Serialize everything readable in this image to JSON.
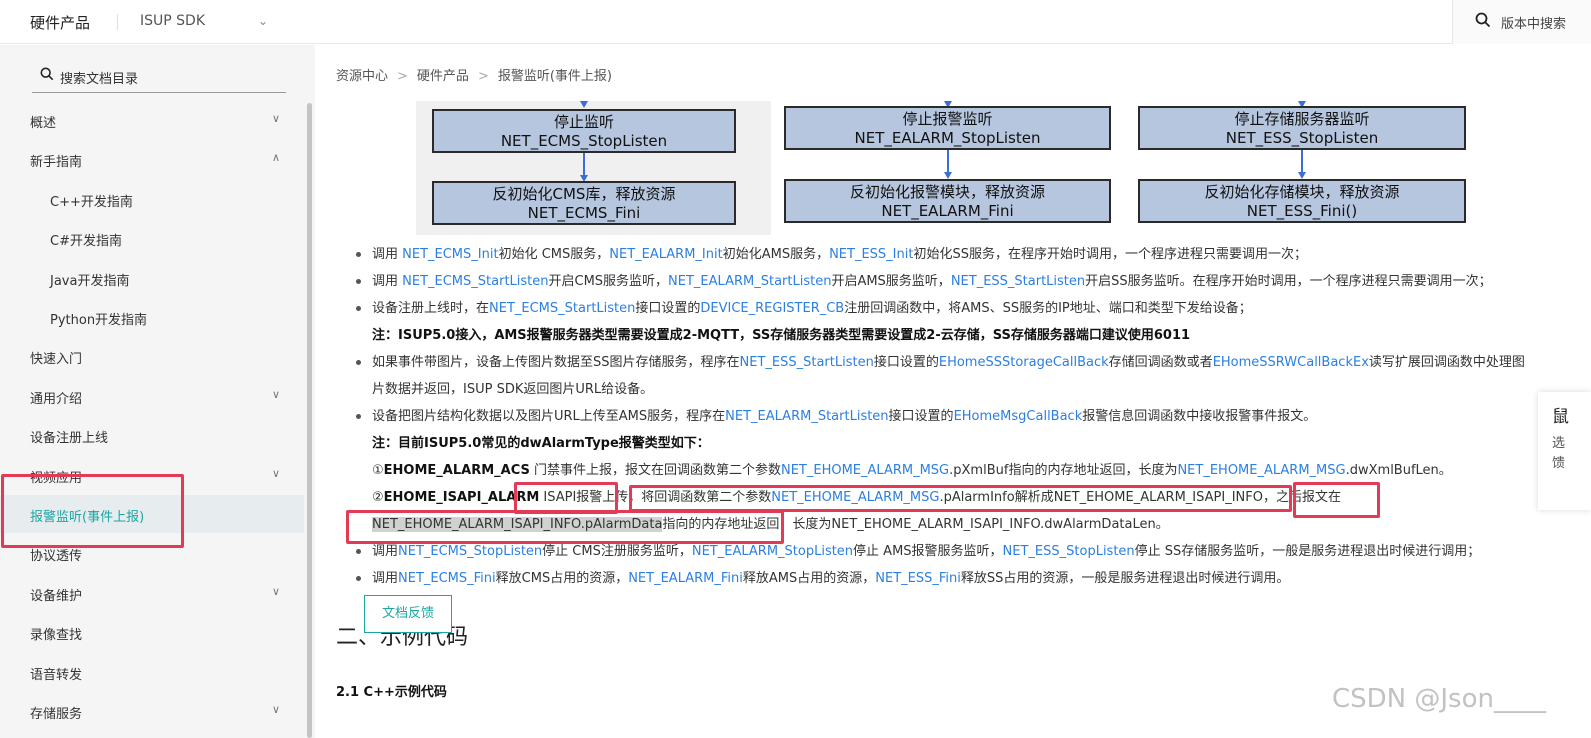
{
  "header": {
    "brand": "硬件产品",
    "product": "ISUP SDK",
    "search_placeholder": "版本中搜索"
  },
  "sidebar": {
    "search_placeholder": "搜索文档目录",
    "items": [
      {
        "label": "概述",
        "chevron": "∨"
      },
      {
        "label": "新手指南",
        "chevron": "∧"
      },
      {
        "label": "C++开发指南",
        "chevron": ""
      },
      {
        "label": "C#开发指南",
        "chevron": ""
      },
      {
        "label": "Java开发指南",
        "chevron": ""
      },
      {
        "label": "Python开发指南",
        "chevron": ""
      },
      {
        "label": "快速入门",
        "chevron": ""
      },
      {
        "label": "通用介绍",
        "chevron": "∨"
      },
      {
        "label": "设备注册上线",
        "chevron": ""
      },
      {
        "label": "视频应用",
        "chevron": "∨"
      },
      {
        "label": "报警监听(事件上报)",
        "chevron": ""
      },
      {
        "label": "协议透传",
        "chevron": ""
      },
      {
        "label": "设备维护",
        "chevron": "∨"
      },
      {
        "label": "录像查找",
        "chevron": ""
      },
      {
        "label": "语音转发",
        "chevron": ""
      },
      {
        "label": "存储服务",
        "chevron": "∨"
      }
    ]
  },
  "breadcrumb": [
    "资源中心",
    "硬件产品",
    "报警监听(事件上报)"
  ],
  "flowchart": {
    "stop_cms": [
      "停止监听",
      "NET_ECMS_StopListen"
    ],
    "fini_cms": [
      "反初始化CMS库，释放资源",
      "NET_ECMS_Fini"
    ],
    "stop_alarm": [
      "停止报警监听",
      "NET_EALARM_StopListen"
    ],
    "fini_alarm": [
      "反初始化报警模块，释放资源",
      "NET_EALARM_Fini"
    ],
    "stop_ess": [
      "停止存储服务器监听",
      "NET_ESS_StopListen"
    ],
    "fini_ess": [
      "反初始化存储模块，释放资源",
      "NET_ESS_Fini()"
    ]
  },
  "content": {
    "b1": [
      "调用 ",
      "NET_ECMS_Init",
      "初始化 CMS服务，",
      "NET_EALARM_Init",
      "初始化AMS服务，",
      "NET_ESS_Init",
      "初始化SS服务，在程序开始时调用，一个程序进程只需要调用一次；"
    ],
    "b2": [
      "调用 ",
      "NET_ECMS_StartListen",
      "开启CMS服务监听，",
      "NET_EALARM_StartListen",
      "开启AMS服务监听，",
      "NET_ESS_StartListen",
      "开启SS服务监听。在程序开始时调用，一个程序进程只需要调用一次；"
    ],
    "b3": [
      "设备注册上线时，在",
      "NET_ECMS_StartListen",
      "接口设置的",
      "DEVICE_REGISTER_CB",
      "注册回调函数中，将AMS、SS服务的IP地址、端口和类型下发给设备；"
    ],
    "note1": "注：ISUP5.0接入，AMS报警服务器类型需要设置成2-MQTT，SS存储服务器类型需要设置成2-云存储，SS存储服务器端口建议使用6011",
    "b4": [
      "如果事件带图片，设备上传图片数据至SS图片存储服务，程序在",
      "NET_ESS_StartListen",
      "接口设置的",
      "EHomeSSStorageCallBack",
      "存储回调函数或者",
      "EHomeSSRWCallBackEx",
      "读写扩展回调函数中处理图"
    ],
    "b4_cont": "片数据并返回，ISUP SDK返回图片URL给设备。",
    "b5": [
      "设备把图片结构化数据以及图片URL上传至AMS服务，程序在",
      "NET_EALARM_StartListen",
      "接口设置的",
      "EHomeMsgCallBack",
      "报警信息回调函数中接收报警事件报文。"
    ],
    "note2": "注：目前ISUP5.0常见的dwAlarmType报警类型如下：",
    "acs": [
      "①",
      "EHOME_ALARM_ACS",
      " 门禁事件上报，报文在回调函数第二个参数",
      "NET_EHOME_ALARM_MSG",
      ".pXmlBuf指向的内存地址返回，长度为",
      "NET_EHOME_ALARM_MSG",
      ".dwXmlBufLen。"
    ],
    "isapi": [
      "②",
      "EHOME_ISAPI_ALARM",
      " ISAPI报警上传，将回调函数第二个参数",
      "NET_EHOME_ALARM_MSG",
      ".pAlarmInfo解析成NET_EHOME_ALARM_ISAPI_INFO，之后报文在"
    ],
    "isapi_cont": [
      "NET_EHOME_ALARM_ISAPI_INFO.pAlarmData",
      "指向的内存地址返回，长度为NET_EHOME_ALARM_ISAPI_INFO.dwAlarmDataLen。"
    ],
    "b6": [
      "调用",
      "NET_ECMS_StopListen",
      "停止 CMS注册服务监听，",
      "NET_EALARM_StopListen",
      "停止 AMS报警服务监听，",
      "NET_ESS_StopListen",
      "停止 SS存储服务监听，一般是服务进程退出时候进行调用；"
    ],
    "b7": [
      "调用",
      "NET_ECMS_Fini",
      "释放CMS占用的资源，",
      "NET_EALARM_Fini",
      "释放AMS占用的资源，",
      "NET_ESS_Fini",
      "释放SS占用的资源，一般是服务进程退出时候进行调用。"
    ],
    "h2": "二、示例代码",
    "h3": "2.1 C++示例代码"
  },
  "feedback_button": "文档反馈",
  "right_panel": [
    "鼠",
    "选",
    "馈"
  ],
  "watermark": "CSDN @Json____",
  "colors": {
    "accent": "#1aa6a2",
    "link": "#2b7fe0",
    "annotation": "#e33a55",
    "flow_box": "#b7c6df"
  }
}
